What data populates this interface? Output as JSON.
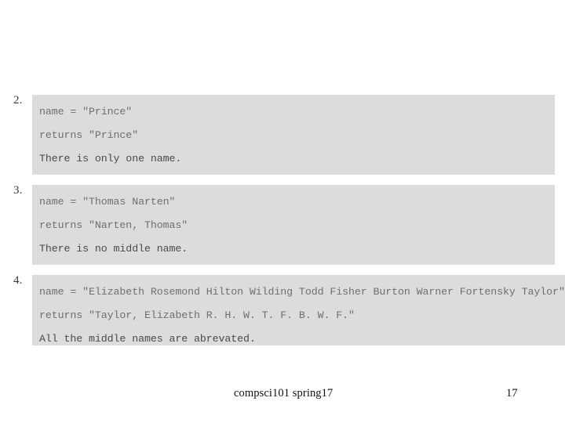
{
  "slide": {
    "background_color": "#ffffff",
    "code_block_color": "#dcdcdc",
    "code_text_color": "#6f6f6f",
    "note_text_color": "#4a4a4a",
    "number_text_color": "#3b3b3b"
  },
  "items": [
    {
      "number": "2.",
      "lines": [
        "name = \"Prince\"",
        "returns \"Prince\"",
        "There is only one name."
      ]
    },
    {
      "number": "3.",
      "lines": [
        "name = \"Thomas Narten\"",
        "returns \"Narten, Thomas\"",
        "There is no middle name."
      ]
    },
    {
      "number": "4.",
      "lines": [
        "name = \"Elizabeth Rosemond Hilton Wilding Todd Fisher Burton Warner Fortensky Taylor\"",
        "returns \"Taylor, Elizabeth R. H. W. T. F. B. W. F.\"",
        "All the middle names are abrevated."
      ]
    }
  ],
  "footer": {
    "course": "compsci101 spring17",
    "page_number": "17"
  }
}
